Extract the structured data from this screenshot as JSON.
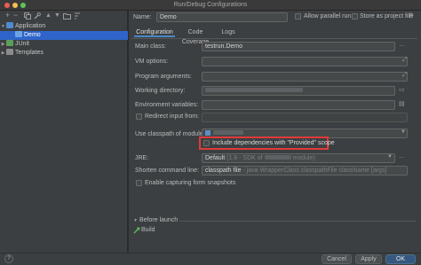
{
  "window": {
    "title": "Run/Debug Configurations"
  },
  "toolbar": {
    "add_icon": "plus-icon",
    "remove_icon": "minus-icon",
    "copy_icon": "copy-icon",
    "settings_icon": "wrench-icon",
    "up_icon": "arrow-up-icon",
    "down_icon": "arrow-down-icon",
    "folder_icon": "folder-icon",
    "sort_icon": "sort-icon"
  },
  "tree": {
    "items": [
      {
        "label": "Application"
      },
      {
        "label": "Demo"
      },
      {
        "label": "JUnit"
      },
      {
        "label": "Templates"
      }
    ]
  },
  "header": {
    "name_label": "Name:",
    "name_value": "Demo",
    "allow_parallel_label": "Allow parallel run",
    "store_label": "Store as project file"
  },
  "tabs": [
    {
      "label": "Configuration"
    },
    {
      "label": "Code Coverage"
    },
    {
      "label": "Logs"
    }
  ],
  "form": {
    "main_class_label": "Main class:",
    "main_class_value": "testrun.Demo",
    "vm_options_label": "VM options:",
    "program_args_label": "Program arguments:",
    "working_dir_label": "Working directory:",
    "env_vars_label": "Environment variables:",
    "redirect_label": "Redirect input from:",
    "classpath_label": "Use classpath of module:",
    "include_provided_label": "Include dependencies with \"Provided\" scope",
    "jre_label": "JRE:",
    "jre_value": "Default",
    "jre_hint": "(1.8 - SDK of",
    "jre_hint2": "module)",
    "shorten_label": "Shorten command line:",
    "shorten_value": "classpath file",
    "shorten_hint": "- java WrapperClass classpathFile className [args]",
    "capture_label": "Enable capturing form snapshots"
  },
  "before_launch": {
    "title": "Before launch",
    "build_label": "Build"
  },
  "buttons": {
    "help": "?",
    "cancel": "Cancel",
    "apply": "Apply",
    "ok": "OK"
  },
  "colors": {
    "selection": "#2f65ca",
    "highlight_box": "#e03a3a",
    "accent": "#4a88c7"
  }
}
